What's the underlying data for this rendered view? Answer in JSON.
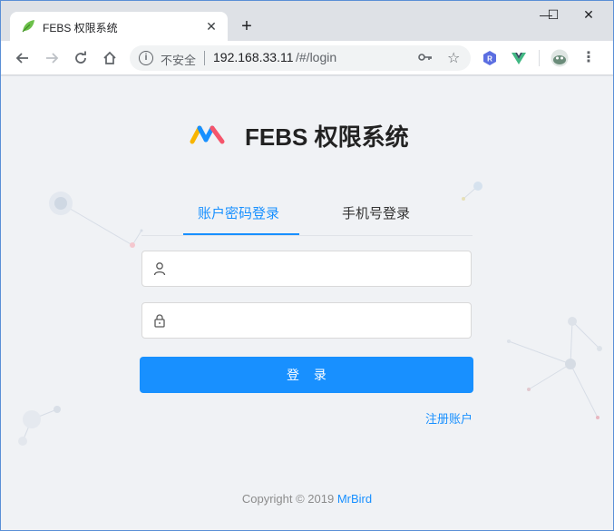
{
  "browser": {
    "tab": {
      "title": "FEBS 权限系统",
      "favicon": "leaf-icon"
    },
    "window_controls": {
      "minimize": "—",
      "maximize": "☐",
      "close": "✕"
    },
    "address": {
      "security_label": "不安全",
      "host": "192.168.33.11",
      "path": "/#/login"
    },
    "extensions": [
      "r-extension-icon",
      "vue-devtools-icon",
      "profile-avatar"
    ]
  },
  "page": {
    "brand_title": "FEBS 权限系统",
    "tabs": [
      {
        "label": "账户密码登录",
        "active": true
      },
      {
        "label": "手机号登录",
        "active": false
      }
    ],
    "username": {
      "value": "",
      "placeholder": "",
      "icon": "user-icon"
    },
    "password": {
      "value": "",
      "placeholder": "",
      "icon": "lock-icon"
    },
    "login_button": "登 录",
    "register_link": "注册账户",
    "footer": {
      "copyright": "Copyright © 2019",
      "author": "MrBird"
    }
  },
  "colors": {
    "primary": "#1890ff",
    "page_bg": "#f0f2f5",
    "chrome_bg": "#dee1e6"
  }
}
